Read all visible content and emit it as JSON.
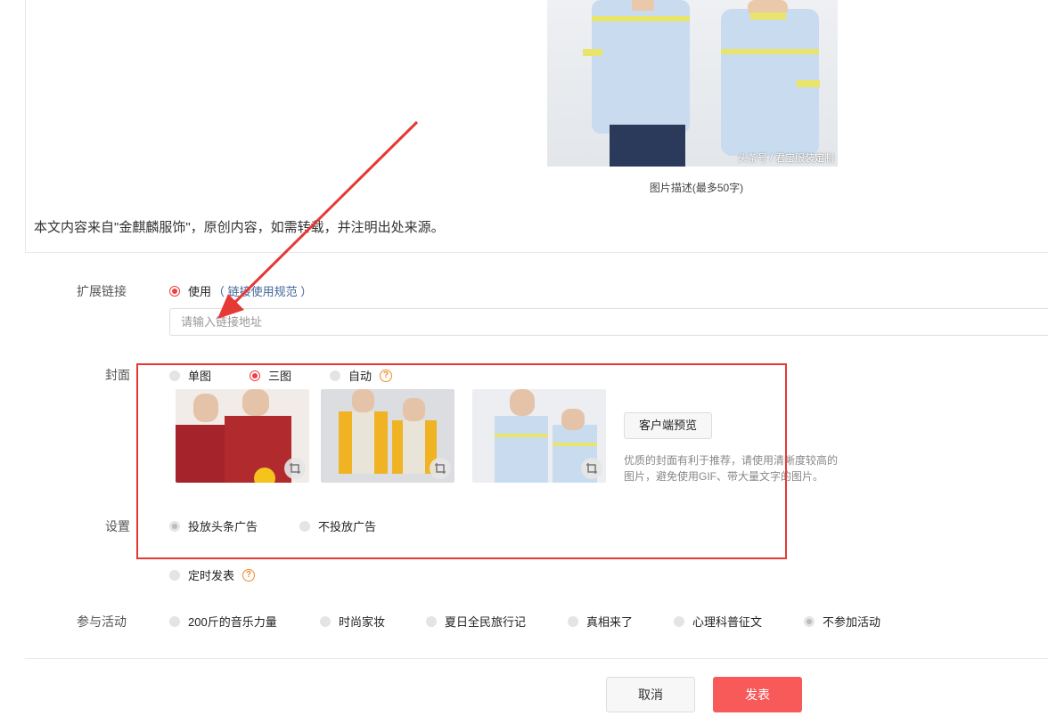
{
  "article": {
    "photo_watermark": "头条号 / 君宝服装定制",
    "caption": "图片描述(最多50字)",
    "source_note": "本文内容来自\"金麒麟服饰\"，原创内容，如需转载，并注明出处来源。"
  },
  "ext_link": {
    "label": "扩展链接",
    "use_label": "使用",
    "rule_link": "（ 链接使用规范 ）",
    "placeholder": "请输入链接地址"
  },
  "cover": {
    "label": "封面",
    "options": [
      "单图",
      "三图",
      "自动"
    ],
    "preview_button": "客户端预览",
    "tip": "优质的封面有利于推荐，请使用清晰度较高的图片，避免使用GIF、带大量文字的图片。"
  },
  "settings": {
    "label": "设置",
    "ad_options": [
      "投放头条广告",
      "不投放广告"
    ],
    "schedule": "定时发表"
  },
  "activity": {
    "label": "参与活动",
    "options": [
      "200斤的音乐力量",
      "时尚家妆",
      "夏日全民旅行记",
      "真相来了",
      "心理科普征文",
      "不参加活动"
    ]
  },
  "actions": {
    "cancel": "取消",
    "publish": "发表"
  },
  "colors": {
    "accent": "#f04142",
    "publish": "#f85959",
    "annotation": "#e53935"
  }
}
